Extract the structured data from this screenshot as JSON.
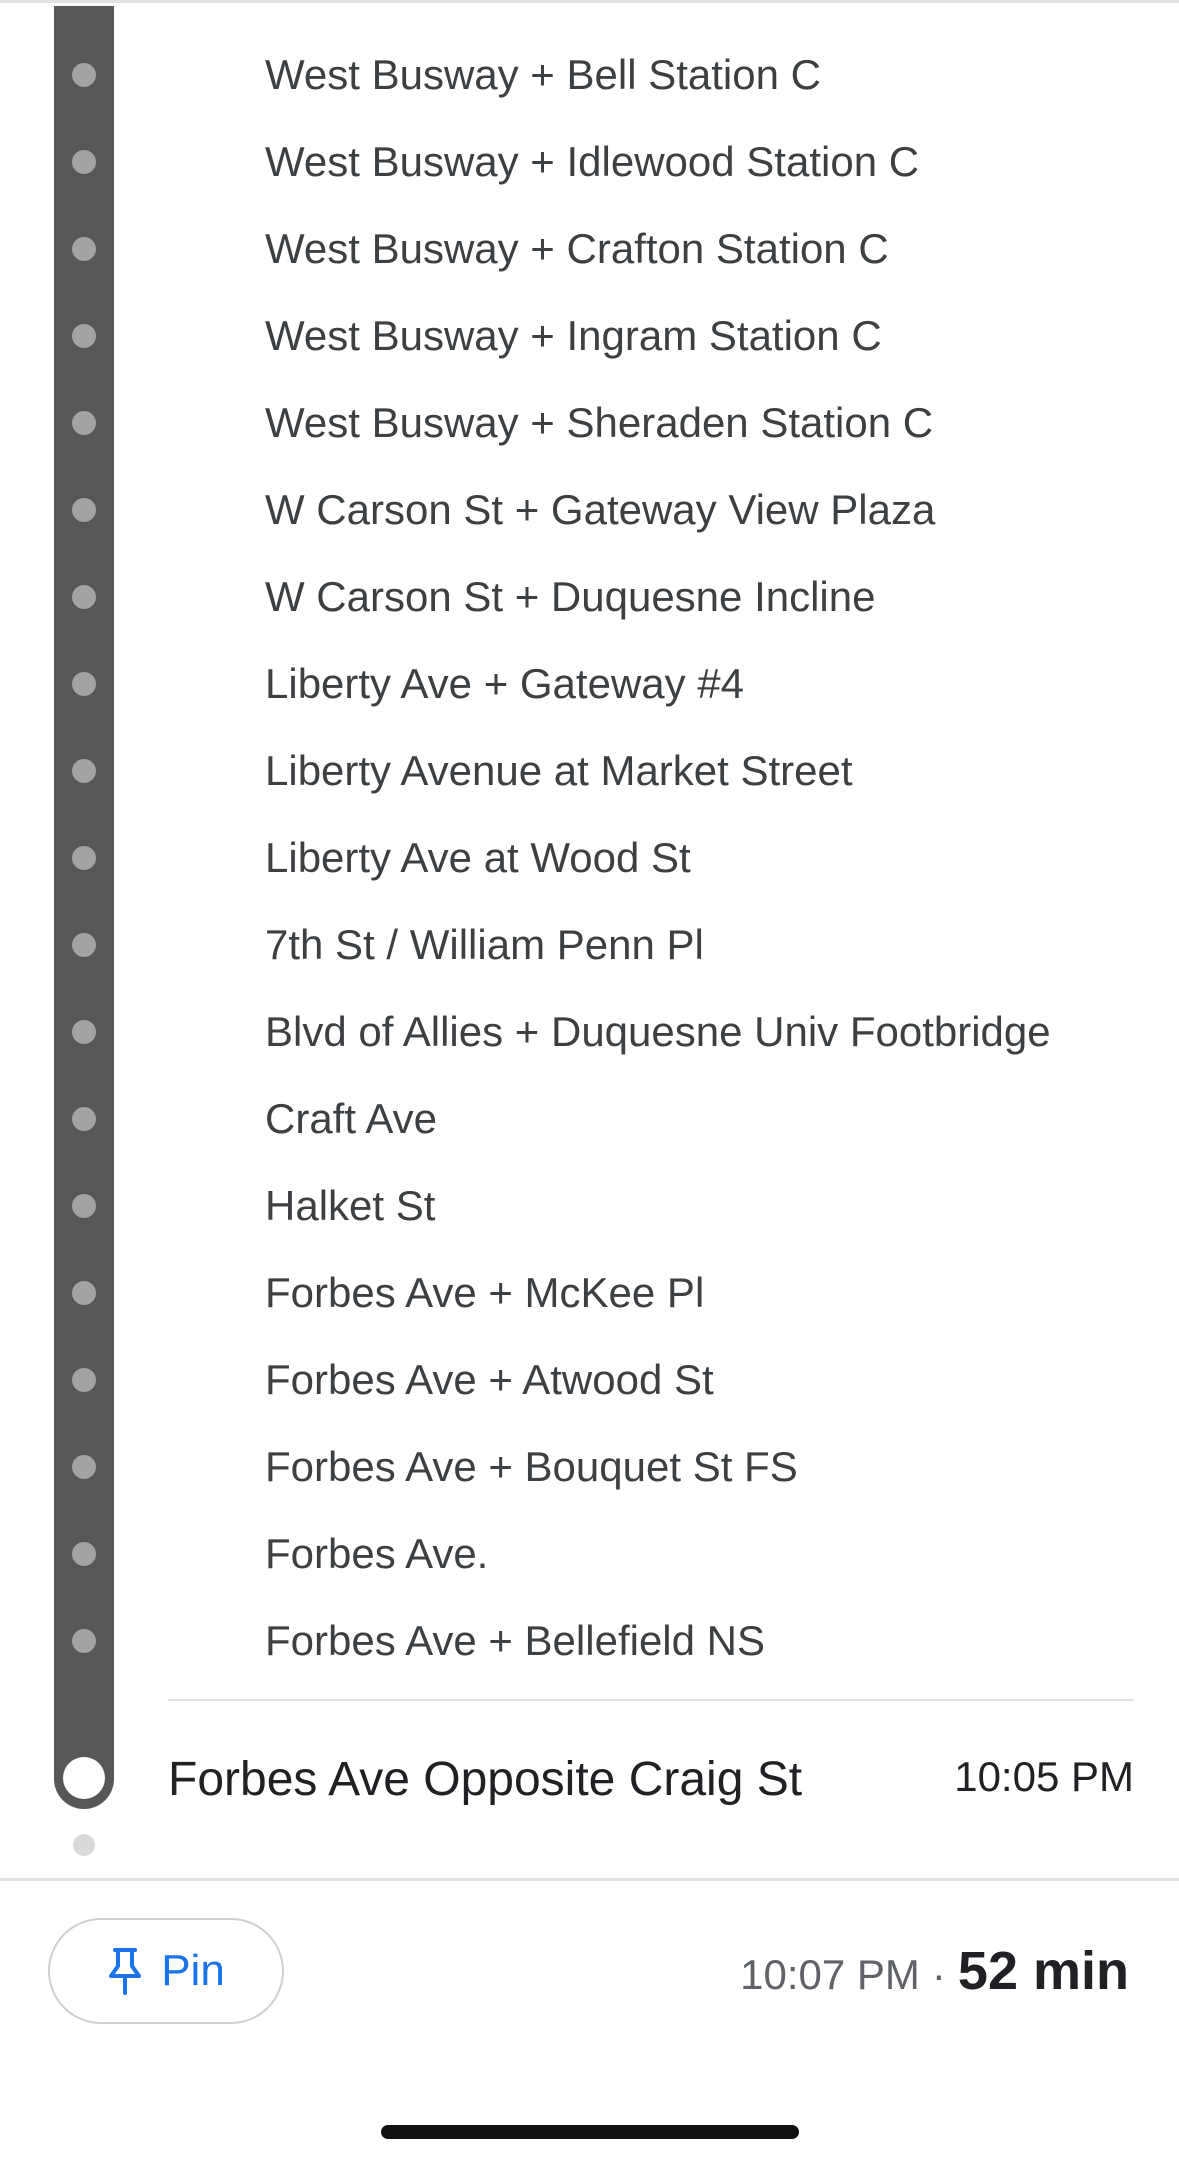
{
  "intermediate_stops": [
    "West Busway + Bell Station C",
    "West Busway + Idlewood Station C",
    "West Busway + Crafton Station C",
    "West Busway + Ingram Station C",
    "West Busway + Sheraden Station C",
    "W Carson St + Gateway View Plaza",
    "W Carson St + Duquesne Incline",
    "Liberty Ave + Gateway #4",
    "Liberty Avenue at Market Street",
    "Liberty Ave at Wood St",
    "7th St / William Penn Pl",
    "Blvd of Allies + Duquesne Univ Footbridge",
    "Craft Ave",
    "Halket St",
    "Forbes Ave + McKee Pl",
    "Forbes Ave + Atwood St",
    "Forbes Ave + Bouquet St FS",
    "Forbes Ave.",
    "Forbes Ave + Bellefield NS"
  ],
  "destination_stop": {
    "name": "Forbes Ave Opposite Craig St",
    "time": "10:05 PM"
  },
  "footer": {
    "pin_label": "Pin",
    "pin_icon": "pin-icon",
    "arrival_time": "10:07 PM",
    "separator": "·",
    "duration": "52 min"
  },
  "colors": {
    "route_line": "#575757",
    "stop_dot": "#a3a3a3",
    "accent": "#1a73e8"
  }
}
